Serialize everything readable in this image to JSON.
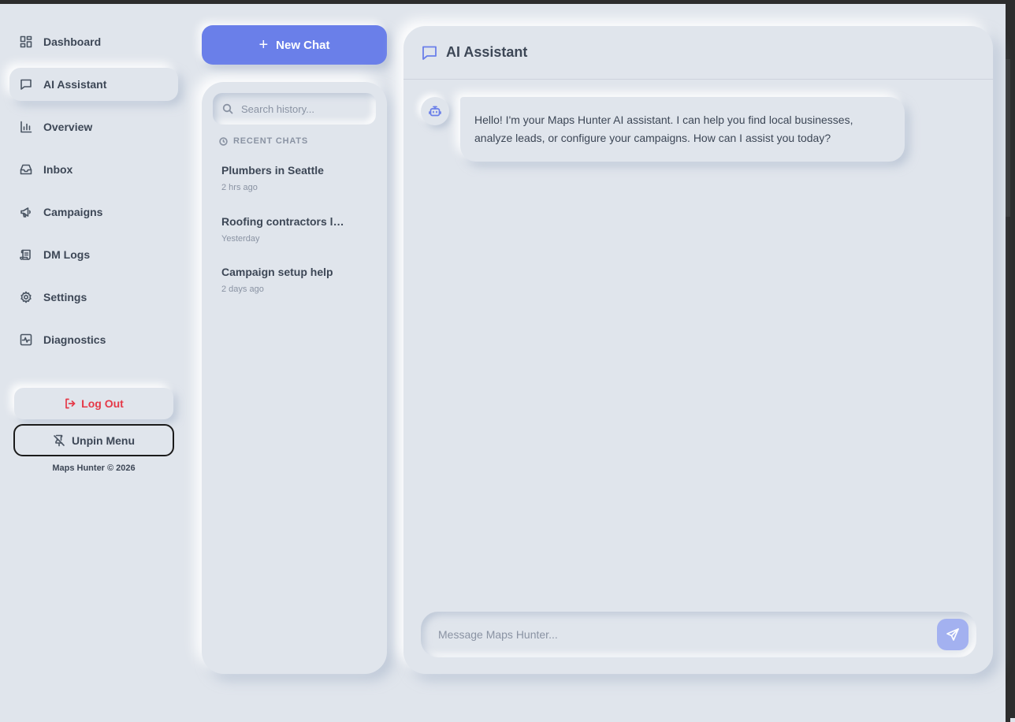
{
  "sidebar": {
    "items": [
      {
        "label": "Dashboard",
        "icon": "dashboard-icon"
      },
      {
        "label": "AI Assistant",
        "icon": "chat-icon",
        "active": true
      },
      {
        "label": "Overview",
        "icon": "bar-chart-icon"
      },
      {
        "label": "Inbox",
        "icon": "inbox-icon"
      },
      {
        "label": "Campaigns",
        "icon": "megaphone-icon"
      },
      {
        "label": "DM Logs",
        "icon": "scroll-icon"
      },
      {
        "label": "Settings",
        "icon": "gear-icon"
      },
      {
        "label": "Diagnostics",
        "icon": "activity-icon"
      }
    ],
    "logout_label": "Log Out",
    "unpin_label": "Unpin Menu",
    "copyright": "Maps Hunter © 2026"
  },
  "history": {
    "new_chat_label": "New Chat",
    "search_placeholder": "Search history...",
    "recent_label": "RECENT CHATS",
    "items": [
      {
        "title": "Plumbers in Seattle",
        "time": "2 hrs ago"
      },
      {
        "title": "Roofing contractors leads",
        "time": "Yesterday"
      },
      {
        "title": "Campaign setup help",
        "time": "2 days ago"
      }
    ]
  },
  "chat": {
    "title": "AI Assistant",
    "messages": [
      {
        "role": "assistant",
        "text": "Hello! I'm your Maps Hunter AI assistant. I can help you find local businesses, analyze leads, or configure your campaigns. How can I assist you today?"
      }
    ],
    "input_placeholder": "Message Maps Hunter..."
  },
  "colors": {
    "background": "#e0e5ec",
    "accent": "#6a7fe9",
    "danger": "#e53948",
    "text": "#3d4756",
    "muted": "#8a93a3"
  }
}
